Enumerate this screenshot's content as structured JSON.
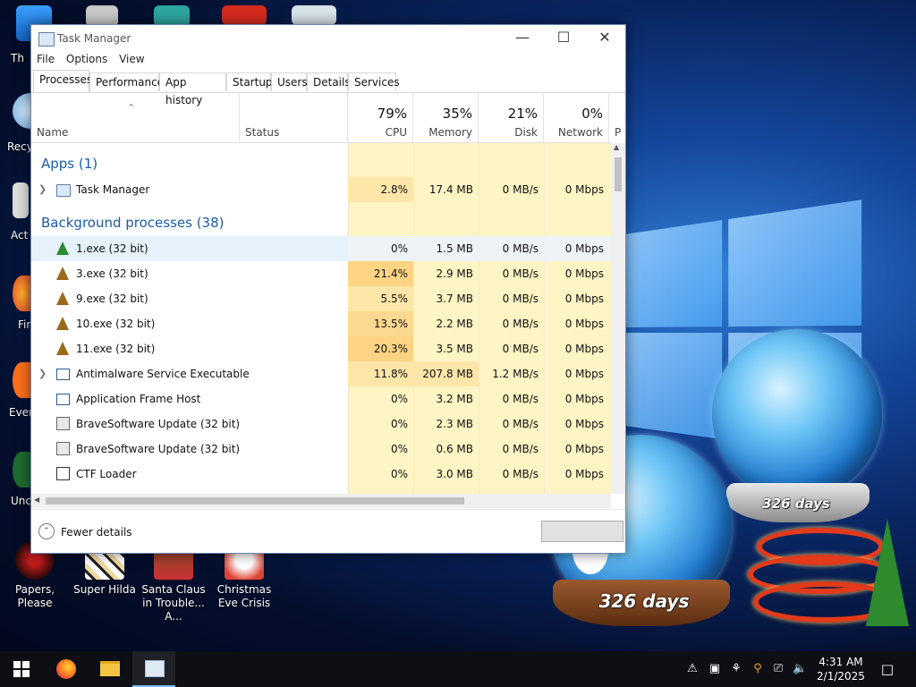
{
  "desktop": {
    "edge_labels": [
      "Th",
      "Recy",
      "Act",
      "Fir",
      "Ever",
      "Unc"
    ],
    "icons": [
      {
        "label": "Papers, Please"
      },
      {
        "label": "Super Hilda"
      },
      {
        "label": "Santa Claus in Trouble... A..."
      },
      {
        "label": "Christmas Eve Crisis"
      }
    ],
    "globe_front_text": "326 days",
    "globe_back_text": "326 days"
  },
  "task_manager": {
    "title": "Task Manager",
    "menu": [
      "File",
      "Options",
      "View"
    ],
    "tabs": [
      "Processes",
      "Performance",
      "App history",
      "Startup",
      "Users",
      "Details",
      "Services"
    ],
    "active_tab": "Processes",
    "columns": {
      "name": "Name",
      "status": "Status",
      "cpu": {
        "pct": "79%",
        "label": "CPU"
      },
      "memory": {
        "pct": "35%",
        "label": "Memory"
      },
      "disk": {
        "pct": "21%",
        "label": "Disk"
      },
      "network": {
        "pct": "0%",
        "label": "Network"
      },
      "power": "P"
    },
    "groups": {
      "apps": "Apps (1)",
      "background": "Background processes (38)"
    },
    "rows": [
      {
        "name": "Task Manager",
        "cpu": "2.8%",
        "memory": "17.4 MB",
        "disk": "0 MB/s",
        "network": "0 Mbps"
      },
      {
        "name": "1.exe (32 bit)",
        "cpu": "0%",
        "memory": "1.5 MB",
        "disk": "0 MB/s",
        "network": "0 Mbps"
      },
      {
        "name": "3.exe (32 bit)",
        "cpu": "21.4%",
        "memory": "2.9 MB",
        "disk": "0 MB/s",
        "network": "0 Mbps"
      },
      {
        "name": "9.exe (32 bit)",
        "cpu": "5.5%",
        "memory": "3.7 MB",
        "disk": "0 MB/s",
        "network": "0 Mbps"
      },
      {
        "name": "10.exe (32 bit)",
        "cpu": "13.5%",
        "memory": "2.2 MB",
        "disk": "0 MB/s",
        "network": "0 Mbps"
      },
      {
        "name": "11.exe (32 bit)",
        "cpu": "20.3%",
        "memory": "3.5 MB",
        "disk": "0 MB/s",
        "network": "0 Mbps"
      },
      {
        "name": "Antimalware Service Executable",
        "cpu": "11.8%",
        "memory": "207.8 MB",
        "disk": "1.2 MB/s",
        "network": "0 Mbps"
      },
      {
        "name": "Application Frame Host",
        "cpu": "0%",
        "memory": "3.2 MB",
        "disk": "0 MB/s",
        "network": "0 Mbps"
      },
      {
        "name": "BraveSoftware Update (32 bit)",
        "cpu": "0%",
        "memory": "2.3 MB",
        "disk": "0 MB/s",
        "network": "0 Mbps"
      },
      {
        "name": "BraveSoftware Update (32 bit)",
        "cpu": "0%",
        "memory": "0.6 MB",
        "disk": "0 MB/s",
        "network": "0 Mbps"
      },
      {
        "name": "CTF Loader",
        "cpu": "0%",
        "memory": "3.0 MB",
        "disk": "0 MB/s",
        "network": "0 Mbps"
      }
    ],
    "fewer_details": "Fewer details"
  },
  "taskbar": {
    "time": "4:31 AM",
    "date": "2/1/2025"
  },
  "colors": {
    "accent": "#1c5ba6",
    "cpu_high": "#fcd483",
    "cpu_mid": "#fde6a8",
    "cell_shade": "#fff4c4"
  }
}
